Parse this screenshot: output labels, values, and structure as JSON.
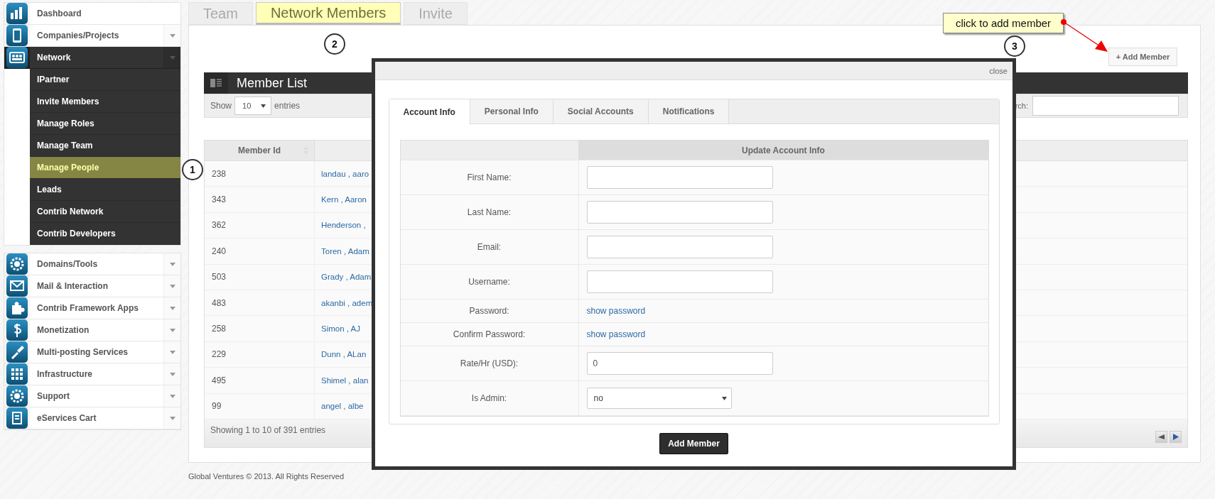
{
  "sidebar": {
    "groups": [
      {
        "items": [
          {
            "label": "Dashboard",
            "expandable": false,
            "expanded": false
          },
          {
            "label": "Companies/Projects",
            "expandable": true,
            "expanded": false
          },
          {
            "label": "Network",
            "expandable": true,
            "expanded": true,
            "children": [
              {
                "label": "IPartner",
                "selected": false
              },
              {
                "label": "Invite Members",
                "selected": false
              },
              {
                "label": "Manage Roles",
                "selected": false
              },
              {
                "label": "Manage Team",
                "selected": false
              },
              {
                "label": "Manage People",
                "selected": true
              },
              {
                "label": "Leads",
                "selected": false
              },
              {
                "label": "Contrib Network",
                "selected": false
              },
              {
                "label": "Contrib Developers",
                "selected": false
              }
            ]
          }
        ]
      },
      {
        "items": [
          {
            "label": "Domains/Tools",
            "expandable": true,
            "expanded": false
          },
          {
            "label": "Mail & Interaction",
            "expandable": true,
            "expanded": false
          },
          {
            "label": "Contrib Framework Apps",
            "expandable": true,
            "expanded": false
          },
          {
            "label": "Monetization",
            "expandable": true,
            "expanded": false
          },
          {
            "label": "Multi-posting Services",
            "expandable": true,
            "expanded": false
          },
          {
            "label": "Infrastructure",
            "expandable": true,
            "expanded": false
          },
          {
            "label": "Support",
            "expandable": true,
            "expanded": false
          },
          {
            "label": "eServices Cart",
            "expandable": true,
            "expanded": false
          }
        ]
      }
    ]
  },
  "tabs": [
    {
      "label": "Team",
      "selected": false
    },
    {
      "label": "Network Members",
      "selected": true
    },
    {
      "label": "Invite",
      "selected": false
    }
  ],
  "add_member_button": "+ Add Member",
  "member_list": {
    "title": "Member List",
    "show_label": "Show",
    "page_size": "10",
    "entries_label": "entries",
    "search_label": "rch:",
    "columns": [
      "Member Id"
    ],
    "rows": [
      {
        "id": "238",
        "name": "landau , aaro"
      },
      {
        "id": "343",
        "name": "Kern , Aaron"
      },
      {
        "id": "362",
        "name": "Henderson ,"
      },
      {
        "id": "240",
        "name": "Toren , Adam"
      },
      {
        "id": "503",
        "name": "Grady , Adam"
      },
      {
        "id": "483",
        "name": "akanbi , adem"
      },
      {
        "id": "258",
        "name": "Simon , AJ"
      },
      {
        "id": "229",
        "name": "Dunn , ALan"
      },
      {
        "id": "495",
        "name": "Shimel , alan"
      },
      {
        "id": "99",
        "name": "angel , albe"
      }
    ],
    "info": "Showing 1 to 10 of 391 entries"
  },
  "modal": {
    "close": "close",
    "tabs": [
      {
        "label": "Account Info",
        "selected": true
      },
      {
        "label": "Personal Info",
        "selected": false
      },
      {
        "label": "Social Accounts",
        "selected": false
      },
      {
        "label": "Notifications",
        "selected": false
      }
    ],
    "form_title": "Update Account Info",
    "fields": [
      {
        "kind": "input",
        "label": "First Name:"
      },
      {
        "kind": "input",
        "label": "Last Name:"
      },
      {
        "kind": "input",
        "label": "Email:"
      },
      {
        "kind": "input",
        "label": "Username:"
      },
      {
        "kind": "link",
        "label": "Password:",
        "link": "show password"
      },
      {
        "kind": "link",
        "label": "Confirm Password:",
        "link": "show password"
      },
      {
        "kind": "input",
        "label": "Rate/Hr (USD):",
        "value": "0"
      },
      {
        "kind": "select",
        "label": "Is Admin:",
        "value": "no"
      }
    ],
    "submit": "Add Member"
  },
  "annotations": {
    "markers": [
      "1",
      "2",
      "3"
    ],
    "callout": "click to add member"
  },
  "footer": "Global Ventures © 2013. All Rights Reserved"
}
